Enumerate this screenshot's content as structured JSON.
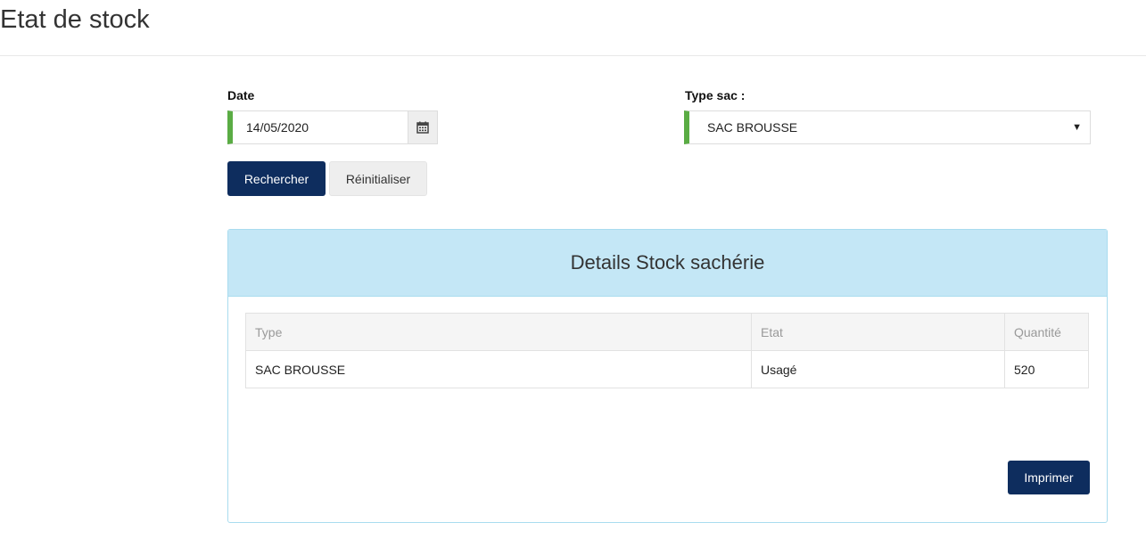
{
  "page": {
    "title": "Etat de stock"
  },
  "form": {
    "date_label": "Date",
    "date_value": "14/05/2020",
    "type_label": "Type sac :",
    "type_value": "SAC BROUSSE",
    "search_label": "Rechercher",
    "reset_label": "Réinitialiser"
  },
  "panel": {
    "title": "Details Stock sachérie",
    "columns": [
      "Type",
      "Etat",
      "Quantité"
    ],
    "rows": [
      {
        "type": "SAC BROUSSE",
        "etat": "Usagé",
        "quantite": "520"
      }
    ],
    "print_label": "Imprimer"
  },
  "icons": {
    "date_addon": "calendar-icon",
    "select_arrow": "caret-down-icon"
  },
  "colors": {
    "primary": "#0e2d5e",
    "valid_border": "#5aac44",
    "panel_heading": "#c4e7f6"
  }
}
